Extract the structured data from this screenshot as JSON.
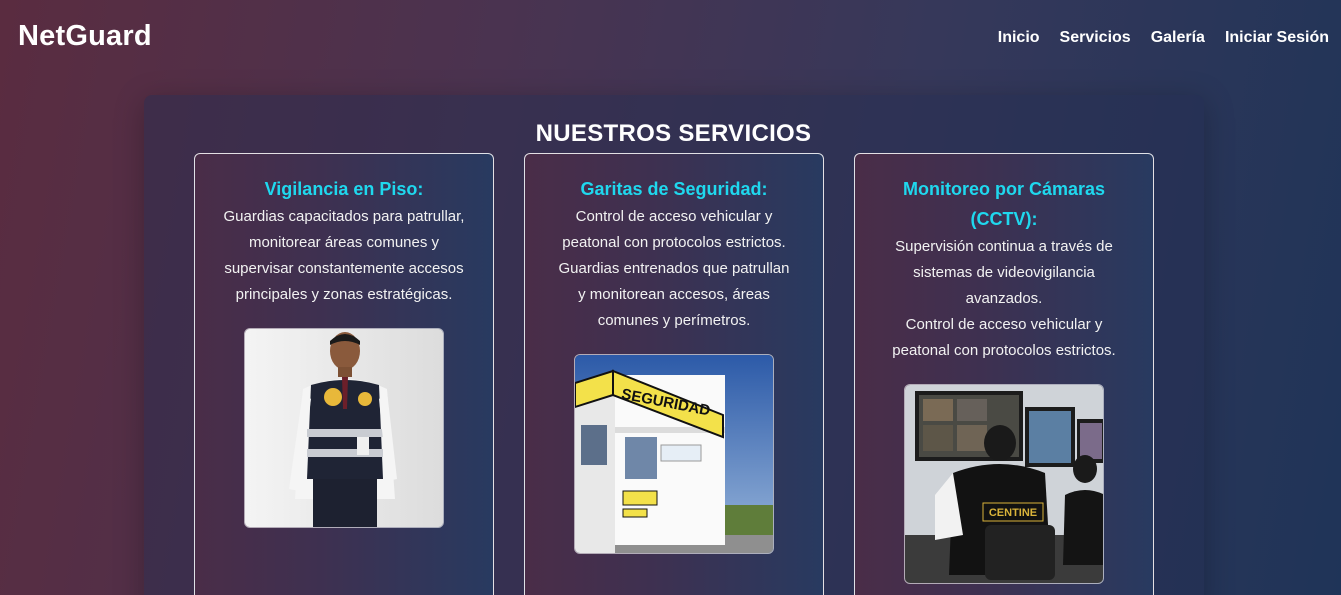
{
  "header": {
    "brand": "NetGuard",
    "nav": [
      "Inicio",
      "Servicios",
      "Galería",
      "Iniciar Sesión"
    ]
  },
  "section": {
    "title": "NUESTROS SERVICIOS"
  },
  "cards": [
    {
      "title": "Vigilancia en Piso:",
      "lines": [
        "Guardias capacitados para patrullar,",
        "monitorear áreas comunes y",
        "supervisar constantemente accesos",
        "principales y zonas estratégicas."
      ]
    },
    {
      "title": "Garitas de Seguridad:",
      "lines": [
        "Control de acceso vehicular y",
        "peatonal con protocolos estrictos.",
        "Guardias entrenados que patrullan",
        "y monitorean accesos, áreas",
        "comunes y perímetros."
      ],
      "sign_text": "SEGURIDAD"
    },
    {
      "title_lines": [
        "Monitoreo por Cámaras",
        "(CCTV):"
      ],
      "lines": [
        "Supervisión continua a través de",
        "sistemas de videovigilancia",
        "avanzados.",
        "Control de acceso vehicular y",
        "peatonal con protocolos estrictos."
      ],
      "vest_text": "CENTINE"
    }
  ],
  "colors": {
    "accent": "#1fd8ee",
    "text": "#ffffff"
  }
}
